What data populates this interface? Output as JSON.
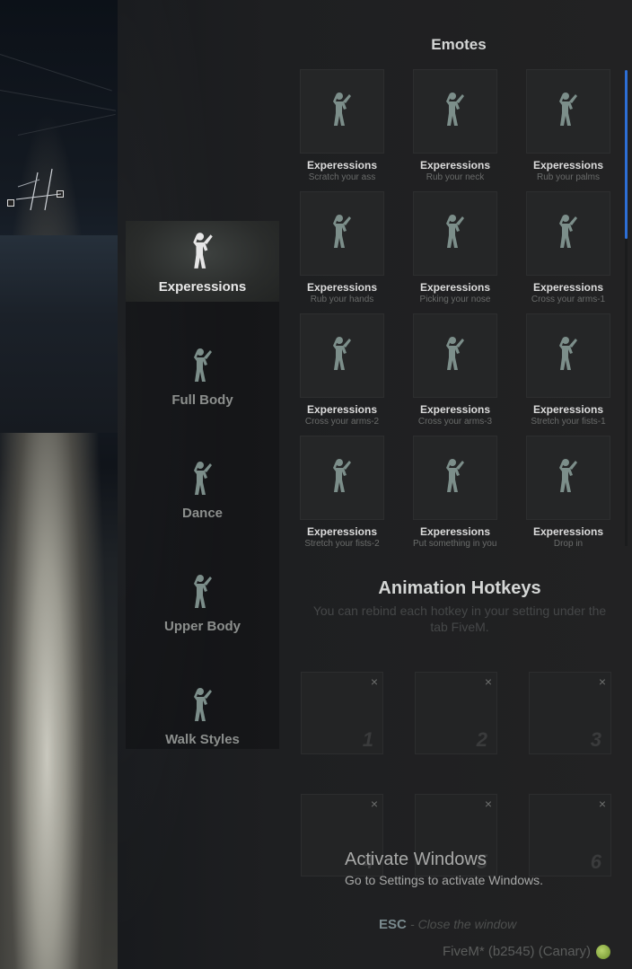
{
  "header": {
    "title": "Emotes"
  },
  "categories": [
    {
      "label": "Experessions",
      "active": true
    },
    {
      "label": "Full Body",
      "active": false
    },
    {
      "label": "Dance",
      "active": false
    },
    {
      "label": "Upper Body",
      "active": false
    },
    {
      "label": "Walk Styles",
      "active": false
    }
  ],
  "emotes": [
    {
      "name": "Experessions",
      "desc": "Scratch your ass"
    },
    {
      "name": "Experessions",
      "desc": "Rub your neck"
    },
    {
      "name": "Experessions",
      "desc": "Rub your palms"
    },
    {
      "name": "Experessions",
      "desc": "Rub your hands"
    },
    {
      "name": "Experessions",
      "desc": "Picking your nose"
    },
    {
      "name": "Experessions",
      "desc": "Cross your arms-1"
    },
    {
      "name": "Experessions",
      "desc": "Cross your arms-2"
    },
    {
      "name": "Experessions",
      "desc": "Cross your arms-3"
    },
    {
      "name": "Experessions",
      "desc": "Stretch your fists-1"
    },
    {
      "name": "Experessions",
      "desc": "Stretch your fists-2"
    },
    {
      "name": "Experessions",
      "desc": "Put something in your"
    },
    {
      "name": "Experessions",
      "desc": "Drop in"
    }
  ],
  "hotkeys": {
    "title": "Animation Hotkeys",
    "subtitle": "You can rebind each hotkey in your setting under the tab FiveM.",
    "close_glyph": "×",
    "slots": [
      "1",
      "2",
      "3",
      "4",
      "5",
      "6"
    ]
  },
  "footer": {
    "esc_key": "ESC",
    "esc_text": "- Close the window"
  },
  "os_watermark": {
    "line1": "Activate Windows",
    "line2": "Go to Settings to activate Windows."
  },
  "client_label": "FiveM* (b2545) (Canary)",
  "colors": {
    "accent_scroll": "#2d6fd6",
    "figure_inactive": "#7c8e8a",
    "figure_active": "#e6e6e6"
  }
}
